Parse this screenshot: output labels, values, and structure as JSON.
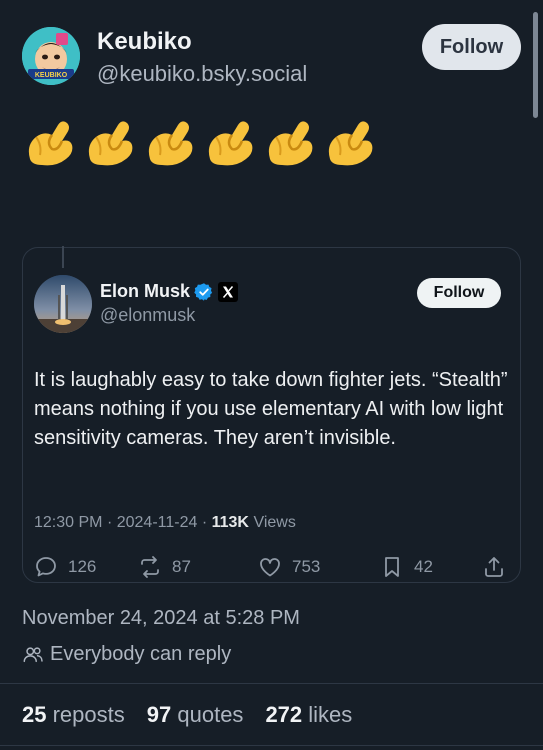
{
  "post": {
    "author_name": "Keubiko",
    "author_handle": "@keubiko.bsky.social",
    "follow_label": "Follow",
    "avatar_text": "KEUBIKO",
    "emoji": "pinched-fingers",
    "emoji_count": 6,
    "timestamp": "November 24, 2024 at 5:28 PM",
    "reply_setting": "Everybody can reply"
  },
  "quote": {
    "author_name": "Elon Musk",
    "author_handle": "@elonmusk",
    "follow_label": "Follow",
    "text": "It is laughably easy to take down fighter jets. “Stealth” means nothing if you use elementary AI with low light sensitivity cameras. They aren’t invisible.",
    "time": "12:30 PM",
    "date": "2024-11-24",
    "views_count": "113K",
    "views_label": "Views",
    "replies": "126",
    "reposts": "87",
    "likes": "753",
    "bookmarks": "42"
  },
  "stats": {
    "reposts_count": "25",
    "reposts_label": "reposts",
    "quotes_count": "97",
    "quotes_label": "quotes",
    "likes_count": "272",
    "likes_label": "likes"
  },
  "colors": {
    "background": "#161e27",
    "verified": "#1d9bf0",
    "follow_bg": "#e1e6ec"
  },
  "icons": [
    "reply-icon",
    "repost-icon",
    "like-icon",
    "bookmark-icon",
    "share-icon",
    "people-icon",
    "verified-icon",
    "x-logo-icon"
  ]
}
